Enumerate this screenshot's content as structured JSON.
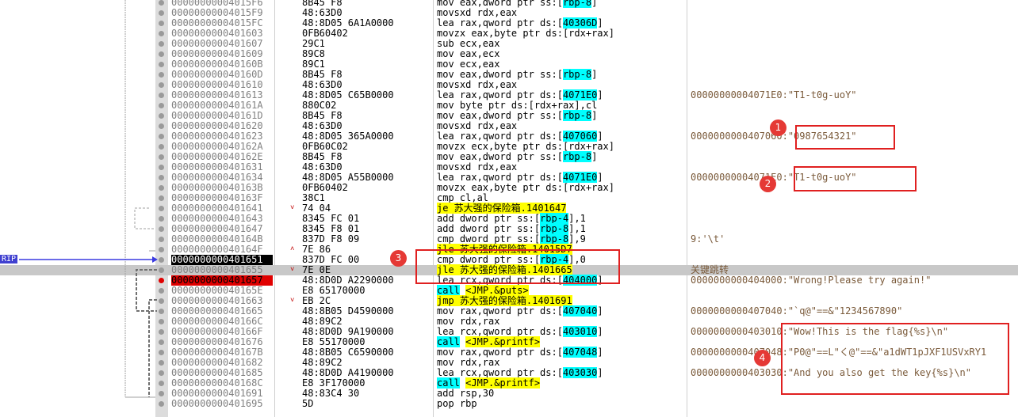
{
  "rip_label": "RIP",
  "rows": [
    {
      "addr": "00000000004015F6",
      "bytes": "8B45 F8",
      "asm": [
        [
          "mov eax,dword ptr ss:[",
          ""
        ],
        [
          "rbp-8",
          "reg"
        ],
        [
          "]",
          ""
        ]
      ],
      "cmt": ""
    },
    {
      "addr": "00000000004015F9",
      "bytes": "48:63D0",
      "asm": [
        [
          "movsxd rdx,eax",
          ""
        ]
      ],
      "cmt": ""
    },
    {
      "addr": "00000000004015FC",
      "bytes": "48:8D05 6A1A0000",
      "asm": [
        [
          "lea rax,qword ptr ds:[",
          ""
        ],
        [
          "40306D",
          "reg"
        ],
        [
          "]",
          ""
        ]
      ],
      "cmt": ""
    },
    {
      "addr": "0000000000401603",
      "bytes": "0FB60402",
      "asm": [
        [
          "movzx eax,byte ptr ds:[rdx+rax]",
          ""
        ]
      ],
      "cmt": ""
    },
    {
      "addr": "0000000000401607",
      "bytes": "29C1",
      "asm": [
        [
          "sub ecx,eax",
          ""
        ]
      ],
      "cmt": ""
    },
    {
      "addr": "0000000000401609",
      "bytes": "89C8",
      "asm": [
        [
          "mov eax,ecx",
          ""
        ]
      ],
      "cmt": ""
    },
    {
      "addr": "000000000040160B",
      "bytes": "89C1",
      "asm": [
        [
          "mov ecx,eax",
          ""
        ]
      ],
      "cmt": ""
    },
    {
      "addr": "000000000040160D",
      "bytes": "8B45 F8",
      "asm": [
        [
          "mov eax,dword ptr ss:[",
          ""
        ],
        [
          "rbp-8",
          "reg"
        ],
        [
          "]",
          ""
        ]
      ],
      "cmt": ""
    },
    {
      "addr": "0000000000401610",
      "bytes": "48:63D0",
      "asm": [
        [
          "movsxd rdx,eax",
          ""
        ]
      ],
      "cmt": ""
    },
    {
      "addr": "0000000000401613",
      "bytes": "48:8D05 C65B0000",
      "asm": [
        [
          "lea rax,qword ptr ds:[",
          ""
        ],
        [
          "4071E0",
          "reg"
        ],
        [
          "]",
          ""
        ]
      ],
      "cmt": "00000000004071E0:\"T1-t0g-uoY\""
    },
    {
      "addr": "000000000040161A",
      "bytes": "880C02",
      "asm": [
        [
          "mov byte ptr ds:[rdx+rax],cl",
          ""
        ]
      ],
      "cmt": ""
    },
    {
      "addr": "000000000040161D",
      "bytes": "8B45 F8",
      "asm": [
        [
          "mov eax,dword ptr ss:[",
          ""
        ],
        [
          "rbp-8",
          "reg"
        ],
        [
          "]",
          ""
        ]
      ],
      "cmt": ""
    },
    {
      "addr": "0000000000401620",
      "bytes": "48:63D0",
      "asm": [
        [
          "movsxd rdx,eax",
          ""
        ]
      ],
      "cmt": ""
    },
    {
      "addr": "0000000000401623",
      "bytes": "48:8D05 365A0000",
      "asm": [
        [
          "lea rax,qword ptr ds:[",
          ""
        ],
        [
          "407060",
          "reg"
        ],
        [
          "]",
          ""
        ]
      ],
      "cmt": "0000000000407060:\"0987654321\""
    },
    {
      "addr": "000000000040162A",
      "bytes": "0FB60C02",
      "asm": [
        [
          "movzx ecx,byte ptr ds:[rdx+rax]",
          ""
        ]
      ],
      "cmt": ""
    },
    {
      "addr": "000000000040162E",
      "bytes": "8B45 F8",
      "asm": [
        [
          "mov eax,dword ptr ss:[",
          ""
        ],
        [
          "rbp-8",
          "reg"
        ],
        [
          "]",
          ""
        ]
      ],
      "cmt": ""
    },
    {
      "addr": "0000000000401631",
      "bytes": "48:63D0",
      "asm": [
        [
          "movsxd rdx,eax",
          ""
        ]
      ],
      "cmt": ""
    },
    {
      "addr": "0000000000401634",
      "bytes": "48:8D05 A55B0000",
      "asm": [
        [
          "lea rax,qword ptr ds:[",
          ""
        ],
        [
          "4071E0",
          "reg"
        ],
        [
          "]",
          ""
        ]
      ],
      "cmt": "00000000004071E0:\"T1-t0g-uoY\""
    },
    {
      "addr": "000000000040163B",
      "bytes": "0FB60402",
      "asm": [
        [
          "movzx eax,byte ptr ds:[rdx+rax]",
          ""
        ]
      ],
      "cmt": ""
    },
    {
      "addr": "000000000040163F",
      "bytes": "38C1",
      "asm": [
        [
          "cmp cl,al",
          ""
        ]
      ],
      "cmt": ""
    },
    {
      "addr": "0000000000401641",
      "bytes": "74 04",
      "arrow": "v",
      "asm": [
        [
          "je",
          "kw"
        ],
        [
          " 苏大强的保险箱.1401647",
          "kw"
        ]
      ],
      "cmt": ""
    },
    {
      "addr": "0000000000401643",
      "bytes": "8345 FC 01",
      "asm": [
        [
          "add dword ptr ss:[",
          ""
        ],
        [
          "rbp-4",
          "reg"
        ],
        [
          "],1",
          ""
        ]
      ],
      "cmt": ""
    },
    {
      "addr": "0000000000401647",
      "bytes": "8345 F8 01",
      "asm": [
        [
          "add dword ptr ss:[",
          ""
        ],
        [
          "rbp-8",
          "reg"
        ],
        [
          "],1",
          ""
        ]
      ],
      "cmt": ""
    },
    {
      "addr": "000000000040164B",
      "bytes": "837D F8 09",
      "asm": [
        [
          "cmp dword ptr ss:[",
          ""
        ],
        [
          "rbp-8",
          "reg"
        ],
        [
          "],9",
          ""
        ]
      ],
      "cmt": "9:'\\t'"
    },
    {
      "addr": "000000000040164F",
      "bytes": "7E 86",
      "arrow": "^",
      "asm": [
        [
          "jle",
          "kw"
        ],
        [
          " 苏大强的保险箱.14015D7",
          "kw"
        ]
      ],
      "cmt": ""
    },
    {
      "addr": "0000000000401651",
      "bytes": "837D FC 00",
      "state": "cur",
      "asm": [
        [
          "cmp dword ptr ss:[",
          ""
        ],
        [
          "rbp-4",
          "reg"
        ],
        [
          "],0",
          ""
        ]
      ],
      "cmt": ""
    },
    {
      "addr": "0000000000401655",
      "bytes": "7E 0E",
      "arrow": "v",
      "hl": true,
      "asm": [
        [
          "jle",
          "kw"
        ],
        [
          " 苏大强的保险箱.1401665",
          "kw"
        ]
      ],
      "cmt": "关键跳转"
    },
    {
      "addr": "0000000000401657",
      "bytes": "48:8D0D A2290000",
      "state": "bp",
      "asm": [
        [
          "lea rcx,qword ptr ds:[",
          ""
        ],
        [
          "404000",
          "reg"
        ],
        [
          "]",
          ""
        ]
      ],
      "cmt": "0000000000404000:\"Wrong!Please try again!\""
    },
    {
      "addr": "000000000040165E",
      "bytes": "E8 65170000",
      "asm": [
        [
          "call",
          "reg"
        ],
        [
          " ",
          ""
        ],
        [
          "<JMP.&puts>",
          "kw"
        ]
      ],
      "cmt": ""
    },
    {
      "addr": "0000000000401663",
      "bytes": "EB 2C",
      "arrow": "v",
      "asm": [
        [
          "jmp 苏大强的保险箱.1401691",
          "kw"
        ]
      ],
      "cmt": ""
    },
    {
      "addr": "0000000000401665",
      "bytes": "48:8B05 D4590000",
      "asm": [
        [
          "mov rax,qword ptr ds:[",
          ""
        ],
        [
          "407040",
          "reg"
        ],
        [
          "]",
          ""
        ]
      ],
      "cmt": "0000000000407040:\"`q@\"==&\"1234567890\""
    },
    {
      "addr": "000000000040166C",
      "bytes": "48:89C2",
      "asm": [
        [
          "mov rdx,rax",
          ""
        ]
      ],
      "cmt": ""
    },
    {
      "addr": "000000000040166F",
      "bytes": "48:8D0D 9A190000",
      "asm": [
        [
          "lea rcx,qword ptr ds:[",
          ""
        ],
        [
          "403010",
          "reg"
        ],
        [
          "]",
          ""
        ]
      ],
      "cmt": "0000000000403010:\"Wow!This is the flag{%s}\\n\""
    },
    {
      "addr": "0000000000401676",
      "bytes": "E8 55170000",
      "asm": [
        [
          "call",
          "reg"
        ],
        [
          " ",
          ""
        ],
        [
          "<JMP.&printf>",
          "kw"
        ]
      ],
      "cmt": ""
    },
    {
      "addr": "000000000040167B",
      "bytes": "48:8B05 C6590000",
      "asm": [
        [
          "mov rax,qword ptr ds:[",
          ""
        ],
        [
          "407048",
          "reg"
        ],
        [
          "]",
          ""
        ]
      ],
      "cmt": "0000000000407048:\"P0@\"==L\"く@\"==&\"a1dWT1pJXF1USVxRY1"
    },
    {
      "addr": "0000000000401682",
      "bytes": "48:89C2",
      "asm": [
        [
          "mov rdx,rax",
          ""
        ]
      ],
      "cmt": ""
    },
    {
      "addr": "0000000000401685",
      "bytes": "48:8D0D A4190000",
      "asm": [
        [
          "lea rcx,qword ptr ds:[",
          ""
        ],
        [
          "403030",
          "reg"
        ],
        [
          "]",
          ""
        ]
      ],
      "cmt": "0000000000403030:\"And you also get the key{%s}\\n\""
    },
    {
      "addr": "000000000040168C",
      "bytes": "E8 3F170000",
      "asm": [
        [
          "call",
          "reg"
        ],
        [
          " ",
          ""
        ],
        [
          "<JMP.&printf>",
          "kw"
        ]
      ],
      "cmt": ""
    },
    {
      "addr": "0000000000401691",
      "bytes": "48:83C4 30",
      "asm": [
        [
          "add rsp,30",
          ""
        ]
      ],
      "cmt": ""
    },
    {
      "addr": "0000000000401695",
      "bytes": "5D",
      "asm": [
        [
          "pop rbp",
          ""
        ]
      ],
      "cmt": ""
    }
  ],
  "annotations": [
    "1",
    "2",
    "3",
    "4"
  ],
  "colors": {
    "highlight": "#c8c8c8",
    "breakpoint": "#e00000",
    "register": "#00ffff",
    "keyword": "#ffff00",
    "annotation": "#e02020",
    "comment": "#7a5a3a",
    "rip": "#4040d0"
  }
}
